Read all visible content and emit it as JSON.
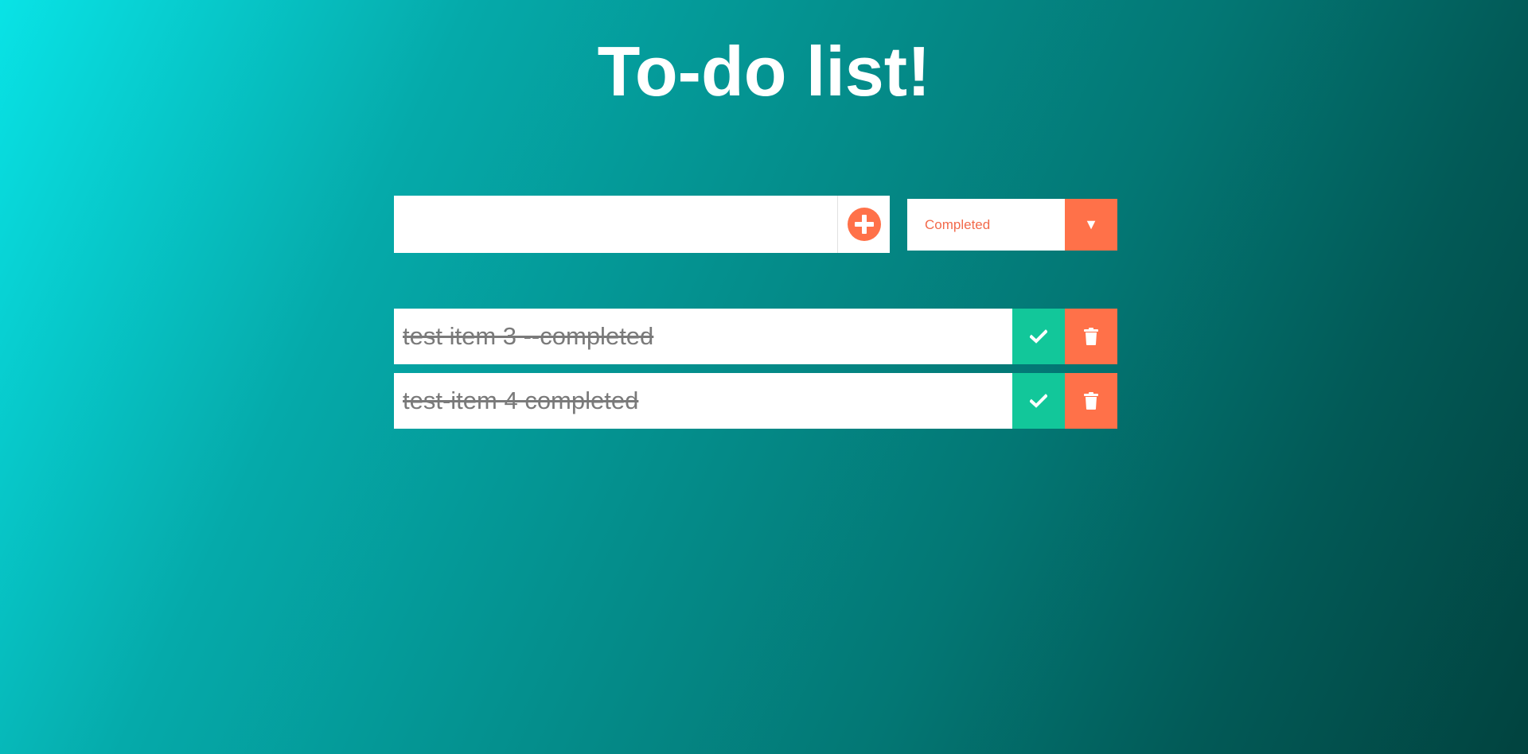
{
  "header": {
    "title": "To-do list!"
  },
  "form": {
    "input_value": "",
    "input_placeholder": "",
    "add_icon": "plus-circle-icon"
  },
  "filter": {
    "selected": "Completed",
    "arrow": "▼"
  },
  "todos": [
    {
      "text": "test item 3 --completed",
      "completed": true
    },
    {
      "text": "test-item 4 completed",
      "completed": true
    }
  ],
  "colors": {
    "accent": "#ff7149",
    "complete": "#12c79a",
    "title": "#ffffff",
    "completed_text": "#7a7a7a"
  }
}
